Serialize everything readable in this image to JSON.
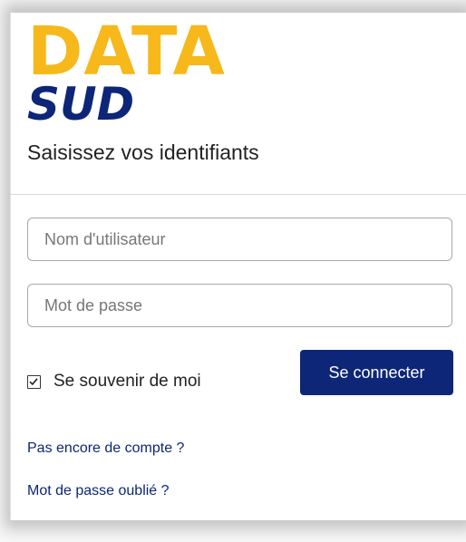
{
  "logo": {
    "line1": "DATA",
    "line2": "SUD",
    "color_primary": "#f6b81a",
    "color_secondary": "#0d2677"
  },
  "subtitle": "Saisissez vos identifiants",
  "form": {
    "username_placeholder": "Nom d'utilisateur",
    "username_value": "",
    "password_placeholder": "Mot de passe",
    "password_value": "",
    "remember_label": "Se souvenir de moi",
    "remember_checked": true,
    "submit_label": "Se connecter",
    "accent_color": "#0d2677"
  },
  "links": {
    "signup": "Pas encore de compte ?",
    "forgot_password": "Mot de passe oublié ?"
  }
}
